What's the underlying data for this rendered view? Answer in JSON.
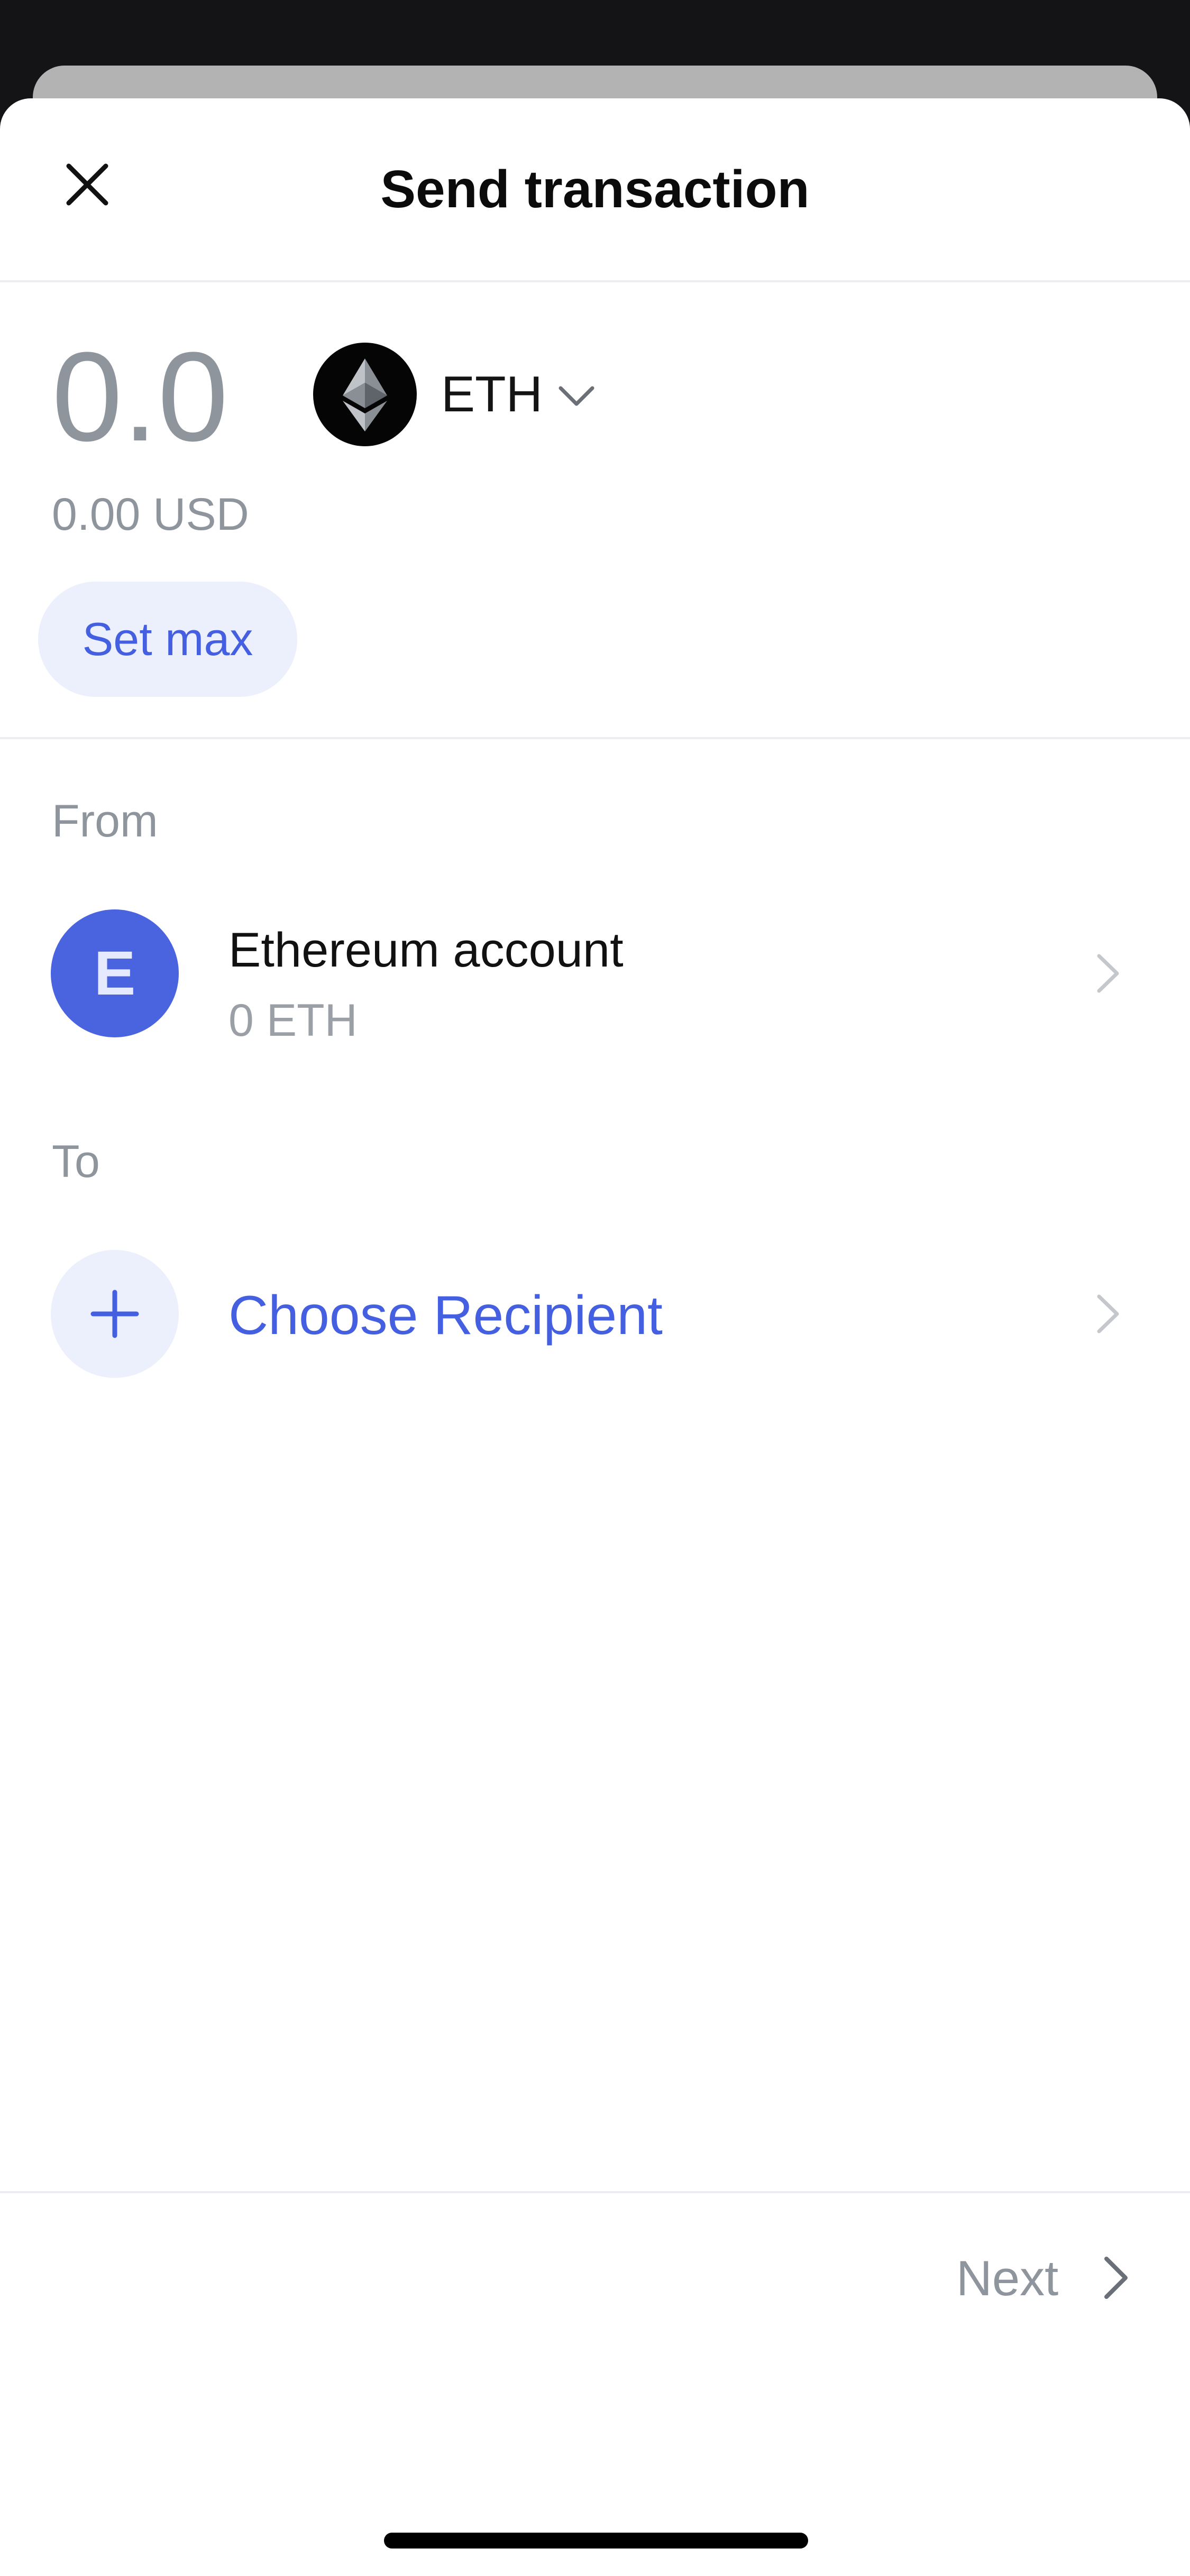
{
  "header": {
    "title": "Send transaction",
    "close_icon": "close-icon"
  },
  "amount": {
    "value": "0.0",
    "token_symbol": "ETH",
    "token_icon": "ethereum-logo-icon",
    "fiat_value": "0.00 USD",
    "set_max_label": "Set max"
  },
  "from": {
    "label": "From",
    "avatar_letter": "E",
    "account_name": "Ethereum account",
    "balance": "0 ETH"
  },
  "to": {
    "label": "To",
    "choose_recipient_label": "Choose Recipient"
  },
  "footer": {
    "next_label": "Next"
  },
  "colors": {
    "accent": "#4460e0",
    "accent_soft": "#eceffc",
    "muted_text": "#8f959c",
    "avatar_bg": "#4a63df",
    "backdrop": "#141416"
  }
}
